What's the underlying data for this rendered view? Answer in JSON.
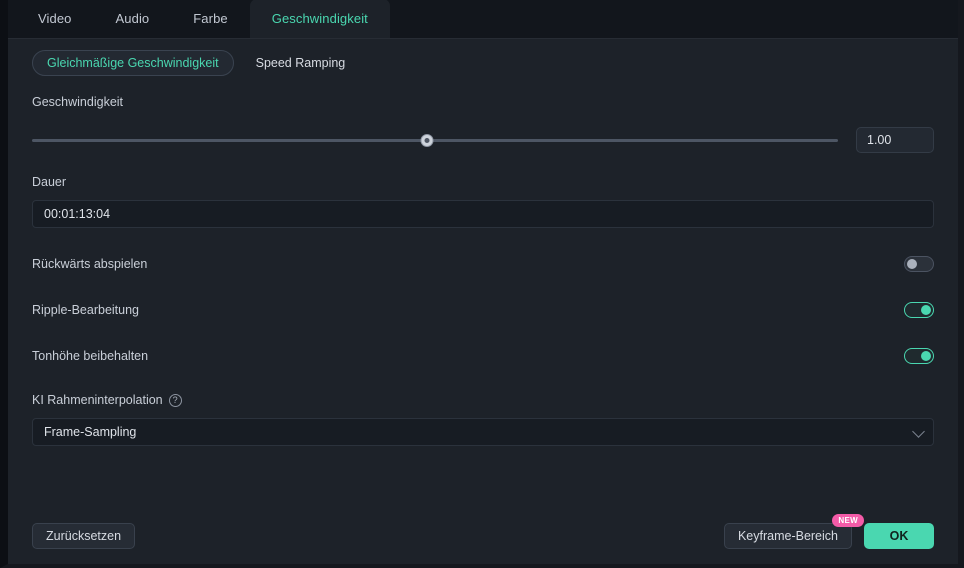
{
  "tabs": [
    {
      "label": "Video",
      "active": false
    },
    {
      "label": "Audio",
      "active": false
    },
    {
      "label": "Farbe",
      "active": false
    },
    {
      "label": "Geschwindigkeit",
      "active": true
    }
  ],
  "subtabs": {
    "uniform": "Gleichmäßige Geschwindigkeit",
    "ramping": "Speed Ramping"
  },
  "speed": {
    "label": "Geschwindigkeit",
    "value": "1.00",
    "slider_percent": 49
  },
  "duration": {
    "label": "Dauer",
    "value": "00:01:13:04"
  },
  "toggles": [
    {
      "label": "Rückwärts abspielen",
      "on": false
    },
    {
      "label": "Ripple-Bearbeitung",
      "on": true
    },
    {
      "label": "Tonhöhe beibehalten",
      "on": true
    }
  ],
  "interpolation": {
    "label": "KI Rahmeninterpolation",
    "help_icon": "question-circle-icon",
    "value": "Frame-Sampling",
    "chevron_icon": "chevron-down-icon"
  },
  "footer": {
    "reset": "Zurücksetzen",
    "keyframe": "Keyframe-Bereich",
    "badge": "NEW",
    "ok": "OK"
  },
  "colors": {
    "accent": "#4ad7b0",
    "badge": "#f45ba8",
    "panel": "#1d2229",
    "tabstrip": "#12161c"
  }
}
